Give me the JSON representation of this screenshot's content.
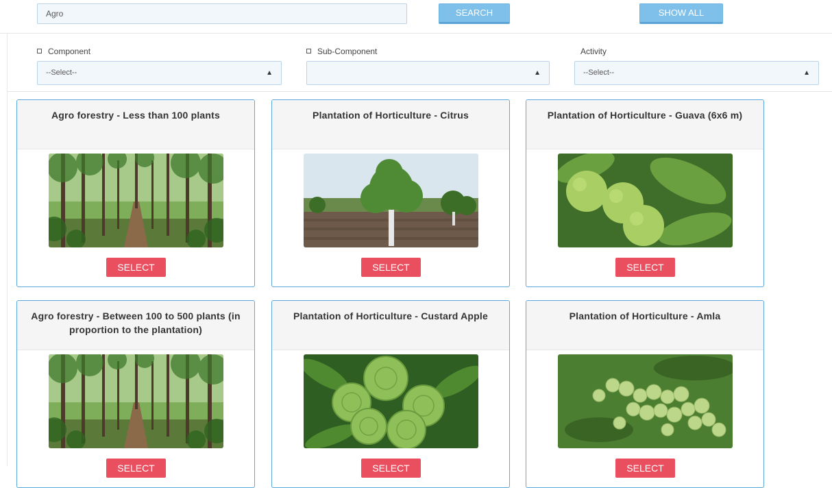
{
  "search": {
    "value": "Agro",
    "search_label": "SEARCH",
    "show_all_label": "SHOW ALL"
  },
  "filters": {
    "component": {
      "label": "Component",
      "selected": "--Select--"
    },
    "sub_component": {
      "label": "Sub-Component",
      "selected": ""
    },
    "activity": {
      "label": "Activity",
      "selected": "--Select--"
    }
  },
  "cards": [
    {
      "title": "Agro forestry - Less than 100 plants",
      "image": "forest-rows-image",
      "button": "SELECT"
    },
    {
      "title": "Plantation of Horticulture - Citrus",
      "image": "citrus-tree-image",
      "button": "SELECT"
    },
    {
      "title": "Plantation of Horticulture - Guava (6x6 m)",
      "image": "guava-fruit-image",
      "button": "SELECT"
    },
    {
      "title": "Agro forestry - Between 100 to 500 plants (in proportion to the plantation)",
      "image": "forest-rows-image",
      "button": "SELECT"
    },
    {
      "title": "Plantation of Horticulture - Custard Apple",
      "image": "custard-apple-image",
      "button": "SELECT"
    },
    {
      "title": "Plantation of Horticulture - Amla",
      "image": "amla-berries-image",
      "button": "SELECT"
    }
  ],
  "colors": {
    "accent_blue": "#7ec0ea",
    "card_border": "#5aa8dc",
    "select_red": "#e94f5f"
  }
}
